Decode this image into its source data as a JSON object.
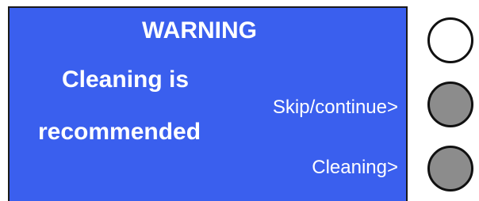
{
  "screen": {
    "title": "WARNING",
    "message_line1": "Cleaning is",
    "message_line2": "recommended",
    "background_color": "#3a5fee",
    "text_color": "#ffffff"
  },
  "options": {
    "skip_label": "Skip/continue>",
    "cleaning_label": "Cleaning>"
  },
  "hardware_buttons": [
    {
      "name": "top",
      "fill_color": "#ffffff"
    },
    {
      "name": "middle",
      "fill_color": "#8c8c8c"
    },
    {
      "name": "bottom",
      "fill_color": "#8c8c8c"
    }
  ]
}
